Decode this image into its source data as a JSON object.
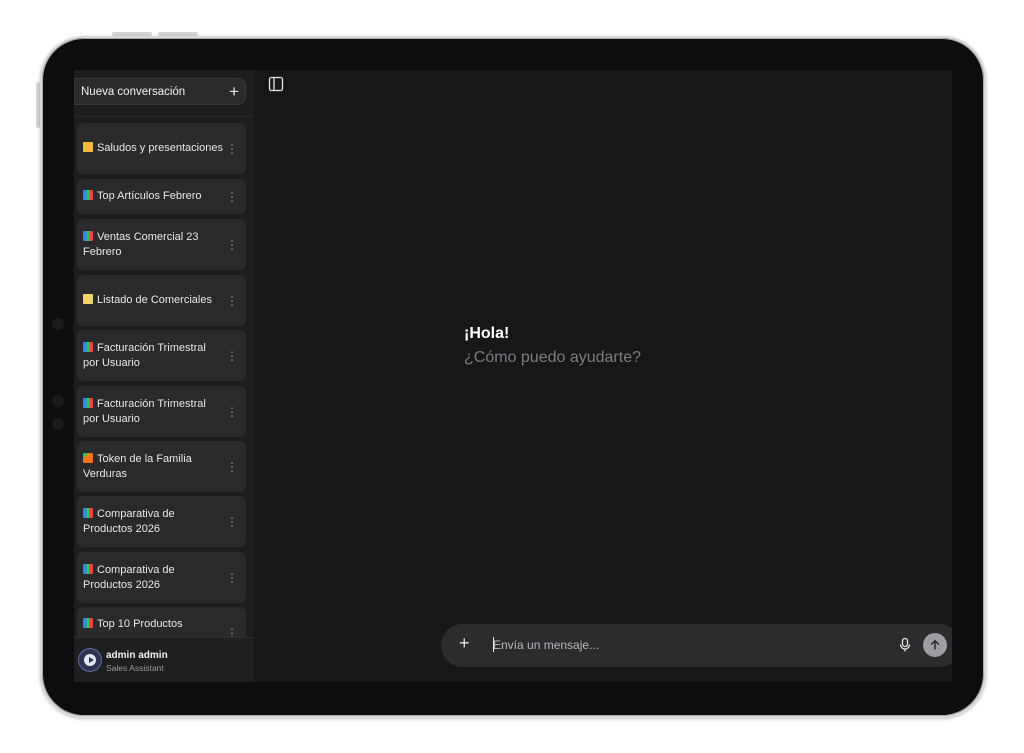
{
  "sidebar": {
    "new_chat_label": "Nueva conversación",
    "new_chat_icon": "+",
    "conversations": [
      {
        "icon": "wave-icon",
        "title": "Saludos y presentaciones"
      },
      {
        "icon": "chart-icon",
        "title": "Top Artículos Febrero"
      },
      {
        "icon": "chart-icon",
        "title": "Ventas Comercial 23 Febrero"
      },
      {
        "icon": "memo-icon",
        "title": "Listado de Comerciales"
      },
      {
        "icon": "chart-icon",
        "title": "Facturación Trimestral por Usuario"
      },
      {
        "icon": "chart-icon",
        "title": "Facturación Trimestral por Usuario"
      },
      {
        "icon": "carrot-icon",
        "title": "Token de la Familia Verduras"
      },
      {
        "icon": "chart-icon",
        "title": "Comparativa de Productos 2026"
      },
      {
        "icon": "chart-icon",
        "title": "Comparativa de Productos 2026"
      },
      {
        "icon": "chart-icon",
        "title": "Top 10 Productos"
      }
    ],
    "menu_glyph": "⋮",
    "user": {
      "name": "admin admin",
      "role": "Sales Assistant"
    }
  },
  "main": {
    "greeting": "¡Hola!",
    "subtitle": "¿Cómo puedo ayudarte?"
  },
  "composer": {
    "attach_icon": "+",
    "placeholder": "Envía un mensaje...",
    "value": ""
  },
  "colors": {
    "background": "#171719",
    "sidebar": "#1d1d20",
    "item": "#2a2a2d",
    "text": "#e8e8e8",
    "muted": "#7c7c80",
    "send_button": "#9e9ea2"
  }
}
